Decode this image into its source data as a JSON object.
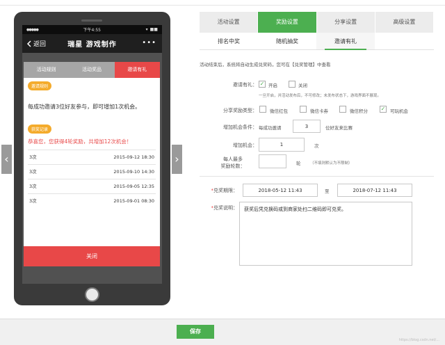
{
  "phone": {
    "status": {
      "signal": "●●●●●",
      "carrier": "▾",
      "time": "下午4:55",
      "battery": "■■"
    },
    "nav": {
      "back_label": "返回",
      "title": "瑞星 游戏制作",
      "more": "•••"
    },
    "dialog": {
      "tabs": [
        "活动规则",
        "活动奖品",
        "邀请有礼"
      ],
      "rule_badge": "邀请规则",
      "rule_text": "每成功邀请3位好友参与，即可增加1次机会。",
      "record_badge": "获奖记录",
      "congrats": "恭喜您，您获得4轮奖励，共增加12次机会！",
      "records": [
        {
          "times": "3次",
          "date": "2015-09-12 18:30"
        },
        {
          "times": "3次",
          "date": "2015-09-10 14:30"
        },
        {
          "times": "3次",
          "date": "2015-09-05 12:35"
        },
        {
          "times": "3次",
          "date": "2015-09-01 08:30"
        }
      ],
      "close_label": "关闭"
    }
  },
  "carousel": {
    "prev": "‹",
    "next": "›"
  },
  "settings": {
    "tabs_main": [
      "活动设置",
      "奖励设置",
      "分享设置",
      "高级设置"
    ],
    "tabs_sub": [
      "排名中奖",
      "随机抽奖",
      "邀请有礼"
    ],
    "description": "活动结束后，系统将自动生成兑奖码，您可在【兑奖管理】中查看",
    "invite": {
      "label": "邀请有礼：",
      "on_label": "开启",
      "off_label": "关闭",
      "hint": "一旦开启，并活动发布后，不可修改；未发布状态下，游戏界面不展现。"
    },
    "share_type": {
      "label": "分享奖励类型：",
      "options": [
        {
          "label": "微信红包",
          "checked": false
        },
        {
          "label": "微信卡券",
          "checked": false
        },
        {
          "label": "微信积分",
          "checked": false
        },
        {
          "label": "可玩机会",
          "checked": true
        }
      ]
    },
    "condition": {
      "label": "增加机会条件：",
      "prefix": "每成功邀请",
      "value": "3",
      "suffix": "位好友来比赛"
    },
    "add_chance": {
      "label": "增加机会：",
      "value": "1",
      "unit": "次"
    },
    "max_rounds": {
      "label_line1": "每人最多",
      "label_line2": "奖励轮数：",
      "value": "",
      "unit": "轮",
      "hint": "（不填则默认为不限制）"
    },
    "period": {
      "label": "兑奖期限：",
      "start": "2018-05-12 11:43",
      "to": "至",
      "end": "2018-07-12 11:43"
    },
    "instructions": {
      "label": "兑奖说明：",
      "text": "获奖后凭兑换码或到商家处扫二维码即可兑奖。"
    }
  },
  "footer": {
    "save_label": "保存",
    "watermark": "https://blog.csdn.net/..."
  },
  "colors": {
    "accent": "#4caf50",
    "danger": "#e84848",
    "badge": "#f4ab2c"
  }
}
